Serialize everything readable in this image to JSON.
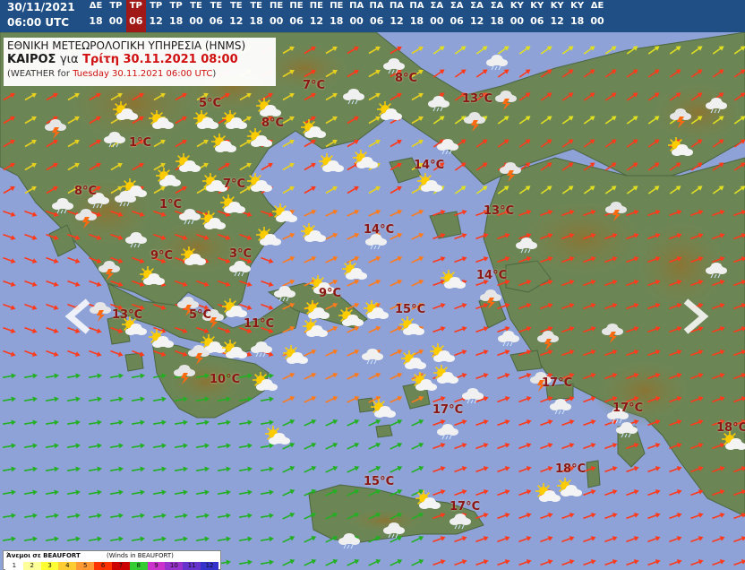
{
  "timebar": {
    "date": "30/11/2021",
    "time": "06:00 UTC",
    "slots": [
      {
        "day": "ΔΕ",
        "hour": "18"
      },
      {
        "day": "ΤΡ",
        "hour": "00"
      },
      {
        "day": "ΤΡ",
        "hour": "06",
        "active": true
      },
      {
        "day": "ΤΡ",
        "hour": "12"
      },
      {
        "day": "ΤΡ",
        "hour": "18"
      },
      {
        "day": "ΤΕ",
        "hour": "00"
      },
      {
        "day": "ΤΕ",
        "hour": "06"
      },
      {
        "day": "ΤΕ",
        "hour": "12"
      },
      {
        "day": "ΤΕ",
        "hour": "18"
      },
      {
        "day": "ΠΕ",
        "hour": "00"
      },
      {
        "day": "ΠΕ",
        "hour": "06"
      },
      {
        "day": "ΠΕ",
        "hour": "12"
      },
      {
        "day": "ΠΕ",
        "hour": "18"
      },
      {
        "day": "ΠΑ",
        "hour": "00"
      },
      {
        "day": "ΠΑ",
        "hour": "06"
      },
      {
        "day": "ΠΑ",
        "hour": "12"
      },
      {
        "day": "ΠΑ",
        "hour": "18"
      },
      {
        "day": "ΣΑ",
        "hour": "00"
      },
      {
        "day": "ΣΑ",
        "hour": "06"
      },
      {
        "day": "ΣΑ",
        "hour": "12"
      },
      {
        "day": "ΣΑ",
        "hour": "18"
      },
      {
        "day": "ΚΥ",
        "hour": "00"
      },
      {
        "day": "ΚΥ",
        "hour": "06"
      },
      {
        "day": "ΚΥ",
        "hour": "12"
      },
      {
        "day": "ΚΥ",
        "hour": "18"
      },
      {
        "day": "ΔΕ",
        "hour": "00"
      }
    ]
  },
  "header": {
    "agency": "ΕΘΝΙΚΗ ΜΕΤΕΩΡΟΛΟΓΙΚΗ ΥΠΗΡΕΣΙΑ (HNMS)",
    "weather_word": "ΚΑΙΡΟΣ",
    "for_word": "για",
    "date_gr": "Τρίτη 30.11.2021 08:00",
    "weather_en_prefix": "(WEATHER for",
    "date_en": "Tuesday 30.11.2021 06:00 UTC",
    "weather_en_suffix": ")"
  },
  "temperatures": [
    {
      "label": "7°C"
    },
    {
      "label": "8°C"
    },
    {
      "label": "5°C"
    },
    {
      "label": "13°C"
    },
    {
      "label": "8°C"
    },
    {
      "label": "1°C"
    },
    {
      "label": "14°C"
    },
    {
      "label": "7°C"
    },
    {
      "label": "8°C"
    },
    {
      "label": "1°C"
    },
    {
      "label": "13°C"
    },
    {
      "label": "14°C"
    },
    {
      "label": "9°C"
    },
    {
      "label": "3°C"
    },
    {
      "label": "14°C"
    },
    {
      "label": "9°C"
    },
    {
      "label": "13°C"
    },
    {
      "label": "5°C"
    },
    {
      "label": "11°C"
    },
    {
      "label": "15°C"
    },
    {
      "label": "10°C"
    },
    {
      "label": "17°C"
    },
    {
      "label": "17°C"
    },
    {
      "label": "17°C"
    },
    {
      "label": "18°C"
    },
    {
      "label": "18°C"
    },
    {
      "label": "15°C"
    },
    {
      "label": "17°C"
    }
  ],
  "legend": {
    "title_gr": "Άνεμοι σε BEAUFORT",
    "title_en": "(Winds in BEAUFORT)",
    "scale": [
      "1",
      "2",
      "3",
      "4",
      "5",
      "6",
      "7",
      "8",
      "9",
      "10",
      "11",
      "12"
    ],
    "colors": [
      "#ffffff",
      "#ffff99",
      "#ffff33",
      "#ffcc33",
      "#ff9933",
      "#ff3300",
      "#cc0000",
      "#33cc33",
      "#cc33cc",
      "#9933cc",
      "#6633cc",
      "#3333cc"
    ]
  },
  "colors": {
    "sea": "#8ea2d8",
    "land": "#6f8a5a",
    "mountain": "#7a6b3c",
    "temp_text": "#8a1616",
    "timebar_bg": "#1f4f84",
    "active_slot": "#a01818"
  },
  "icons": [
    "sun-cloud-icon",
    "rain-cloud-icon",
    "thunder-cloud-icon",
    "sun-icon",
    "cloud-icon",
    "wind-arrow-icon"
  ]
}
